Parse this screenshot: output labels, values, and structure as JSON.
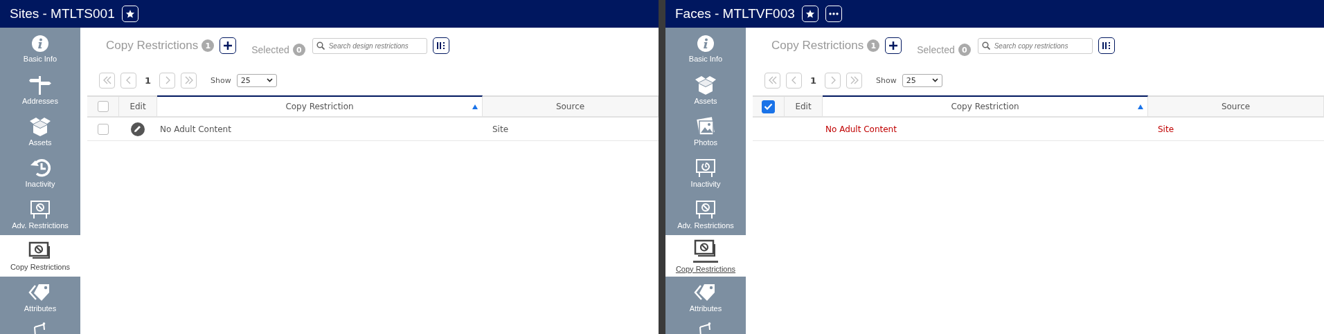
{
  "panels": [
    {
      "title": "Sites - MTLTS001",
      "header_buttons": [
        {
          "kind": "star"
        }
      ],
      "sidebar": [
        {
          "label": "Basic Info",
          "kind": "info",
          "selected": false,
          "focused": false
        },
        {
          "label": "Addresses",
          "kind": "signpost",
          "selected": false,
          "focused": false
        },
        {
          "label": "Assets",
          "kind": "box",
          "selected": false,
          "focused": false
        },
        {
          "label": "Inactivity",
          "kind": "history",
          "selected": false,
          "focused": false
        },
        {
          "label": "Adv. Restrictions",
          "kind": "easel-ban",
          "selected": false,
          "focused": false
        },
        {
          "label": "Copy Restrictions",
          "kind": "copy-ban",
          "selected": true,
          "focused": false
        },
        {
          "label": "Attributes",
          "kind": "tag",
          "selected": false,
          "focused": false
        },
        {
          "kind": "easel-partial",
          "selected": false
        }
      ],
      "section": {
        "title": "Copy Restrictions",
        "count": "1",
        "selected_label": "Selected",
        "selected_count": "0",
        "search_placeholder": "Search design restrictions"
      },
      "pager": {
        "page": "1",
        "show_label": "Show",
        "page_size": "25"
      },
      "table": {
        "header_checked": false,
        "columns": [
          {
            "label": "Edit",
            "sorted": false
          },
          {
            "label": "Copy Restriction",
            "sorted": true
          },
          {
            "label": "Source",
            "sorted": false
          }
        ],
        "rows": [
          {
            "copy_restriction": "No Adult Content",
            "source": "Site",
            "selected": false,
            "editable": true
          }
        ]
      }
    },
    {
      "title": "Faces - MTLTVF003",
      "header_buttons": [
        {
          "kind": "star"
        },
        {
          "kind": "more"
        }
      ],
      "sidebar": [
        {
          "label": "Basic Info",
          "kind": "info",
          "selected": false,
          "focused": false
        },
        {
          "label": "Assets",
          "kind": "box",
          "selected": false,
          "focused": false
        },
        {
          "label": "Photos",
          "kind": "photos",
          "selected": false,
          "focused": false
        },
        {
          "label": "Inactivity",
          "kind": "easel-clock",
          "selected": false,
          "focused": false
        },
        {
          "label": "Adv. Restrictions",
          "kind": "easel-ban",
          "selected": false,
          "focused": false
        },
        {
          "label": "Copy Restrictions",
          "kind": "copy-ban",
          "selected": true,
          "focused": true
        },
        {
          "label": "Attributes",
          "kind": "tag",
          "selected": false,
          "focused": false
        },
        {
          "kind": "easel-partial",
          "selected": false
        }
      ],
      "section": {
        "title": "Copy Restrictions",
        "count": "1",
        "selected_label": "Selected",
        "selected_count": "0",
        "search_placeholder": "Search copy restrictions"
      },
      "pager": {
        "page": "1",
        "show_label": "Show",
        "page_size": "25"
      },
      "table": {
        "header_checked": true,
        "columns": [
          {
            "label": "Edit",
            "sorted": false
          },
          {
            "label": "Copy Restriction",
            "sorted": true
          },
          {
            "label": "Source",
            "sorted": false
          }
        ],
        "rows": [
          {
            "copy_restriction": "No Adult Content",
            "source": "Site",
            "selected": true,
            "editable": false
          }
        ]
      }
    }
  ]
}
